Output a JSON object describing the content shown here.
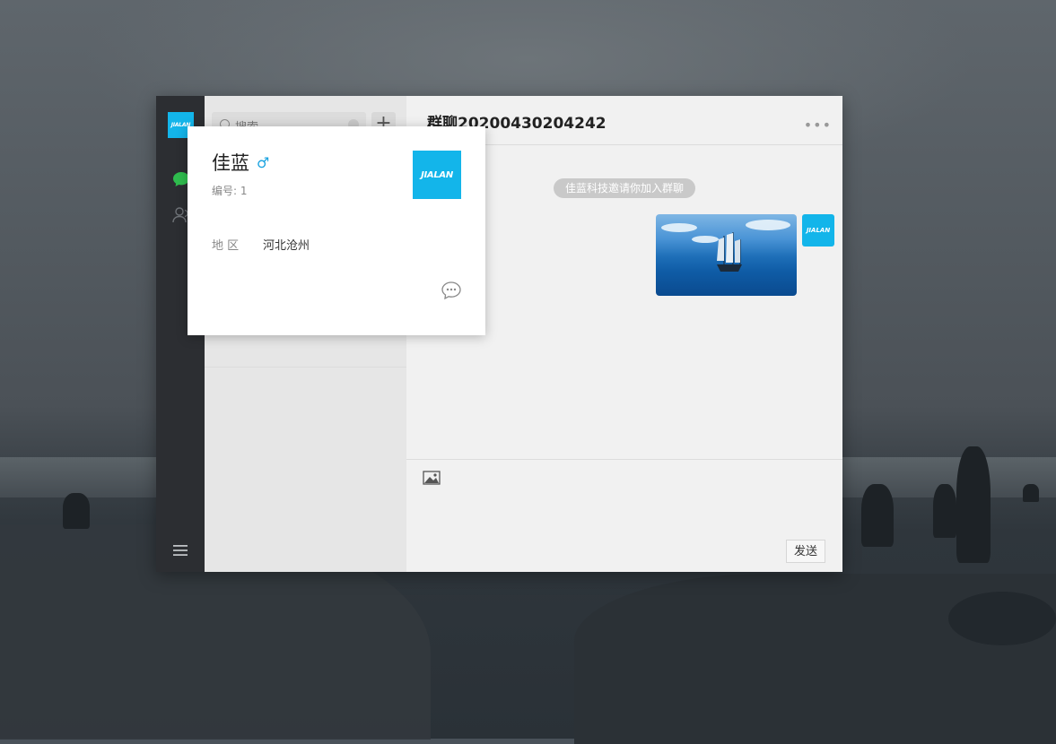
{
  "brand": {
    "logo_text": "JIALAN",
    "accent": "#13b5ea"
  },
  "sidebar": {
    "icons": [
      "chat-bubble-icon",
      "contacts-icon",
      "menu-icon"
    ]
  },
  "contacts": {
    "search_placeholder": "搜索",
    "add_label": "+"
  },
  "chat": {
    "title": "群聊20200430204242",
    "more_label": "•••",
    "system_message": "佳蓝科技邀请你加入群聊",
    "send_label": "发送"
  },
  "profile_card": {
    "name": "佳蓝",
    "gender_symbol": "♂",
    "id_text": "编号: 1",
    "region_label": "地 区",
    "region_value": "河北沧州"
  }
}
